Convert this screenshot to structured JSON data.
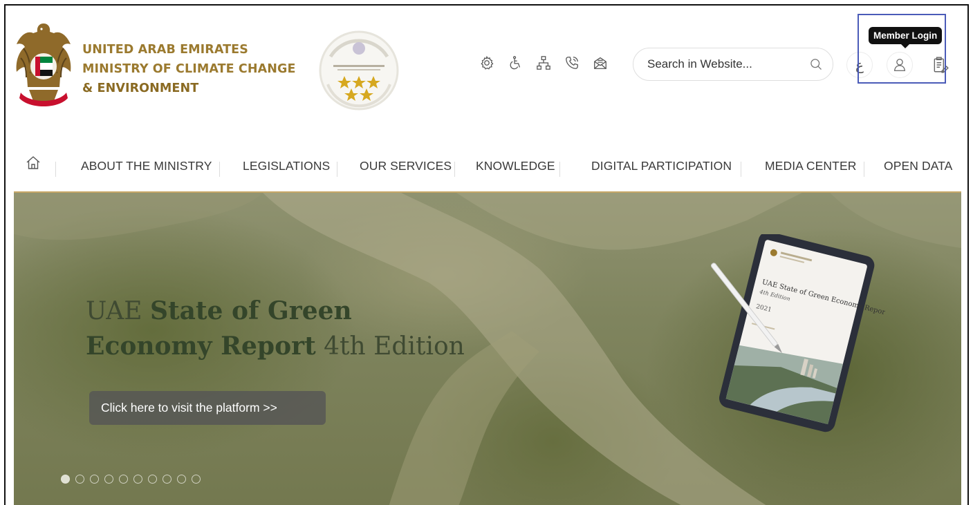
{
  "header": {
    "ministry_line1": "UNITED ARAB EMIRATES",
    "ministry_line2": "MINISTRY OF CLIMATE CHANGE",
    "ministry_line3": "& ENVIRONMENT",
    "search_placeholder": "Search in Website...",
    "language_label": "ع",
    "tooltip": "Member Login",
    "tools": [
      "settings-icon",
      "accessibility-icon",
      "sitemap-icon",
      "call-icon",
      "mail-icon"
    ]
  },
  "nav": {
    "items": [
      "ABOUT THE MINISTRY",
      "LEGISLATIONS",
      "OUR SERVICES",
      "KNOWLEDGE",
      "DIGITAL PARTICIPATION",
      "MEDIA CENTER",
      "OPEN DATA"
    ]
  },
  "hero": {
    "title_prefix": "UAE ",
    "title_bold1": "State of Green",
    "title_bold2": "Economy Report",
    "title_suffix": " 4th Edition",
    "cta": "Click here to visit the platform >>",
    "slide_count": 10,
    "active_slide": 1,
    "tablet_title": "UAE State of Green Economy Report",
    "tablet_edition": "4th Edition",
    "tablet_year": "2021"
  },
  "colors": {
    "gold": "#9b7a2f",
    "nav_line": "#c8a867",
    "highlight": "#4a5bb8"
  }
}
